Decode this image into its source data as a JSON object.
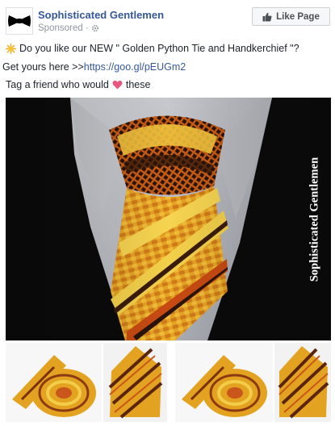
{
  "post": {
    "page_name": "Sophisticated Gentlemen",
    "sponsored_label": "Sponsored ·",
    "like_page_label": "Like Page",
    "line1_text": "Do you like our NEW \" Golden Python Tie and Handkerchief \"?",
    "line2_prefix": "Get yours here >>",
    "line2_link": "https://goo.gl/pEUGm2",
    "line3_before": "Tag a friend who would",
    "line3_after": "these",
    "watermark": "Sophisticated Gentlemen"
  },
  "icons": {
    "avatar": "bowtie-logo",
    "sponsored": "gear-icon",
    "like": "thumbs-up-icon",
    "line1": "sparkle-emoji",
    "line3": "heart-emoji"
  },
  "colors": {
    "link": "#365899",
    "text": "#1d2129",
    "muted": "#90949c",
    "tie_gold": "#e3a321",
    "tie_orange": "#c9561a",
    "heart": "#e8567c"
  }
}
